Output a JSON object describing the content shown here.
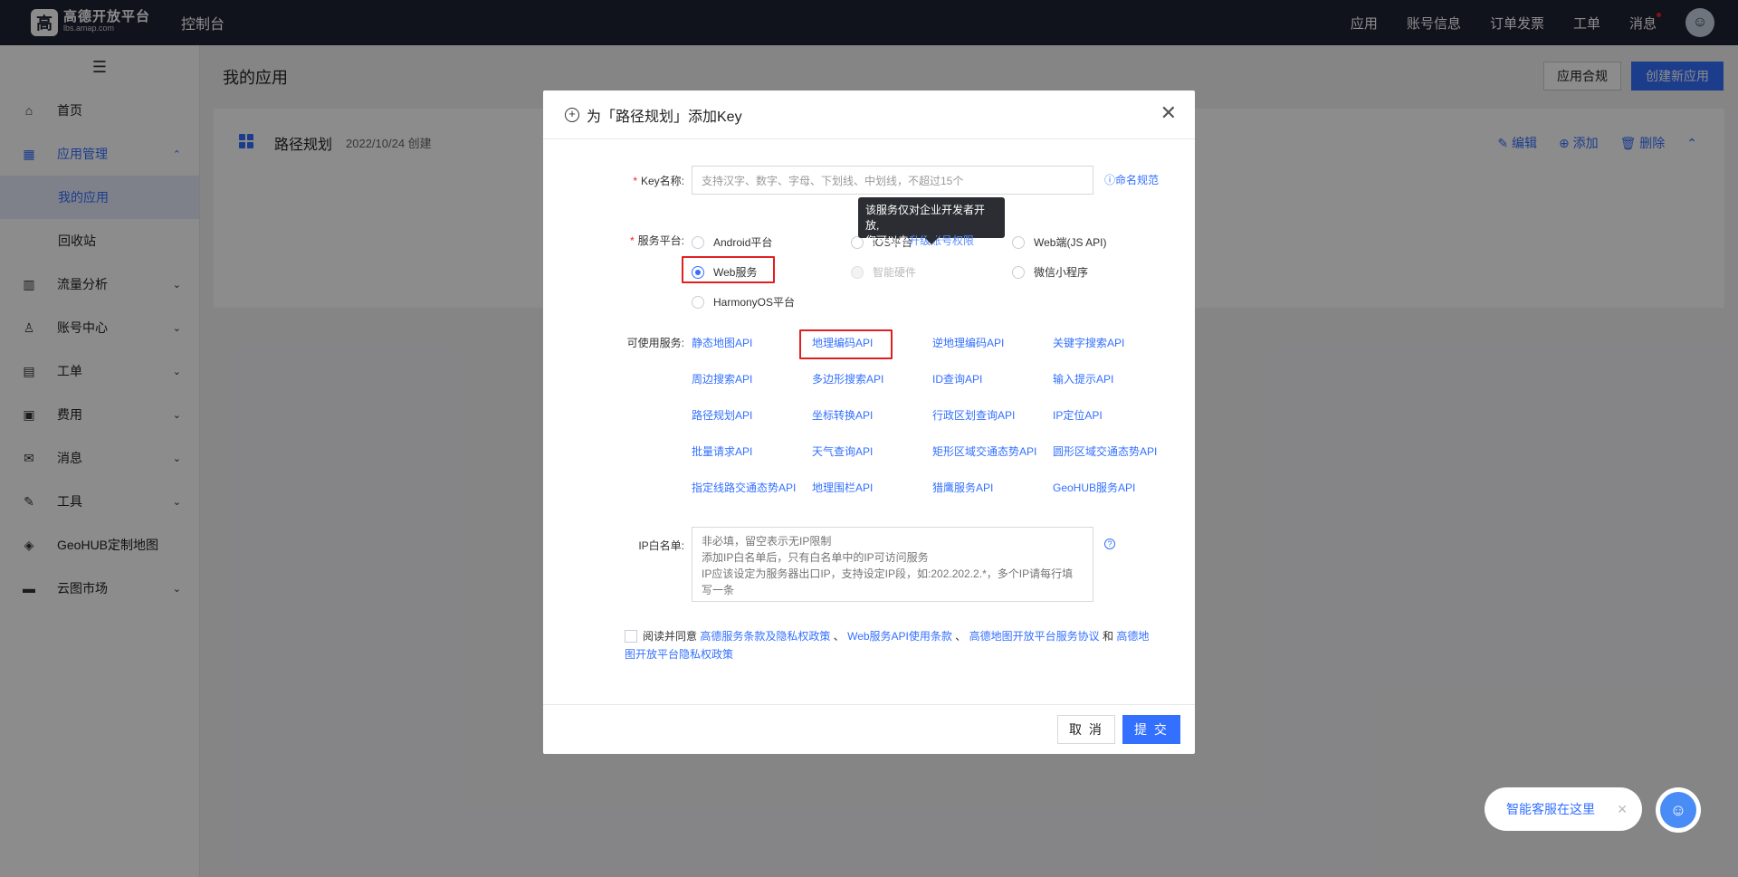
{
  "topbar": {
    "logo": {
      "mark": "高",
      "name": "高德开放平台",
      "domain": "lbs.amap.com"
    },
    "console": "控制台",
    "nav": [
      "应用",
      "账号信息",
      "订单发票",
      "工单",
      "消息"
    ]
  },
  "sidebar": {
    "collapse_icon": "☰",
    "items": [
      {
        "label": "首页",
        "icon": "⌂",
        "arrow": ""
      },
      {
        "label": "应用管理",
        "icon": "▦",
        "arrow": "⌃"
      },
      {
        "label": "流量分析",
        "icon": "▥",
        "arrow": "⌄"
      },
      {
        "label": "账号中心",
        "icon": "♙",
        "arrow": "⌄"
      },
      {
        "label": "工单",
        "icon": "▤",
        "arrow": "⌄"
      },
      {
        "label": "费用",
        "icon": "▣",
        "arrow": "⌄"
      },
      {
        "label": "消息",
        "icon": "✉",
        "arrow": "⌄"
      },
      {
        "label": "工具",
        "icon": "✎",
        "arrow": "⌄"
      },
      {
        "label": "GeoHUB定制地图",
        "icon": "◈",
        "arrow": ""
      },
      {
        "label": "云图市场",
        "icon": "▬",
        "arrow": "⌄"
      }
    ],
    "sub_items": [
      "我的应用",
      "回收站"
    ]
  },
  "main": {
    "title": "我的应用",
    "compliance_button": "应用合规",
    "create_button": "创建新应用",
    "app": {
      "name": "路径规划",
      "created": "2022/10/24 创建",
      "actions": [
        "编辑",
        "添加",
        "删除"
      ],
      "action_icons": [
        "✎",
        "⊕",
        "🗑"
      ],
      "collapse": "⌃"
    }
  },
  "modal": {
    "title": "为「路径规划」添加Key",
    "close": "✕",
    "key_label": "Key名称:",
    "key_placeholder": "支持汉字、数字、字母、下划线、中划线，不超过15个",
    "naming_link": "命名规范",
    "platform_label": "服务平台:",
    "platforms": [
      "Android平台",
      "iOS平台",
      "Web端(JS API)",
      "Web服务",
      "智能硬件",
      "微信小程序",
      "HarmonyOS平台"
    ],
    "selected_platform": "Web服务",
    "tooltip_line1": "该服务仅对企业开发者开放,",
    "tooltip_line2_prefix": "您可以去",
    "tooltip_link": "升级账号权限",
    "services_label": "可使用服务:",
    "services": [
      "静态地图API",
      "地理编码API",
      "逆地理编码API",
      "关键字搜索API",
      "周边搜索API",
      "多边形搜索API",
      "ID查询API",
      "输入提示API",
      "路径规划API",
      "坐标转换API",
      "行政区划查询API",
      "IP定位API",
      "批量请求API",
      "天气查询API",
      "矩形区域交通态势API",
      "圆形区域交通态势API",
      "指定线路交通态势API",
      "地理围栏API",
      "猎鹰服务API",
      "GeoHUB服务API"
    ],
    "ip_label": "IP白名单:",
    "ip_placeholder": "非必填，留空表示无IP限制\n添加IP白名单后，只有白名单中的IP可访问服务\nIP应该设定为服务器出口IP，支持设定IP段，如:202.202.2.*，多个IP请每行填写一条",
    "agree": {
      "prefix": "阅读并同意",
      "link1": "高德服务条款及隐私权政策",
      "sep1": "、",
      "link2": "Web服务API使用条款",
      "sep2": "、",
      "link3": "高德地图开放平台服务协议",
      "and": "和",
      "link4": "高德地图开放平台隐私权政策"
    },
    "cancel": "取 消",
    "submit": "提 交"
  },
  "assistant": {
    "label": "智能客服在这里",
    "close": "✕"
  }
}
